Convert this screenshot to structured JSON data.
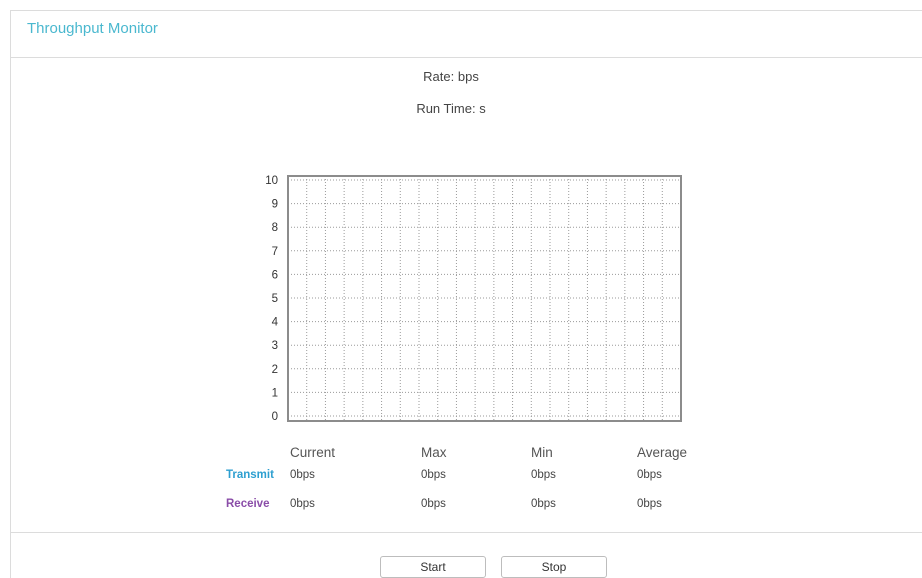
{
  "panel": {
    "title": "Throughput Monitor"
  },
  "rate": {
    "label": "Rate:",
    "unit": "bps"
  },
  "run_time": {
    "label": "Run Time:",
    "unit": "s"
  },
  "chart_data": {
    "type": "line",
    "y_ticks": [
      "0",
      "1",
      "2",
      "3",
      "4",
      "5",
      "6",
      "7",
      "8",
      "9",
      "10"
    ],
    "ylim": [
      0,
      10
    ],
    "series": [],
    "grid": true
  },
  "stats": {
    "headers": [
      "Current",
      "Max",
      "Min",
      "Average"
    ],
    "rows": [
      {
        "label": "Transmit",
        "color": "#2e9fd0",
        "values": [
          "0bps",
          "0bps",
          "0bps",
          "0bps"
        ]
      },
      {
        "label": "Receive",
        "color": "#8a4da8",
        "values": [
          "0bps",
          "0bps",
          "0bps",
          "0bps"
        ]
      }
    ]
  },
  "buttons": {
    "start": "Start",
    "stop": "Stop"
  }
}
